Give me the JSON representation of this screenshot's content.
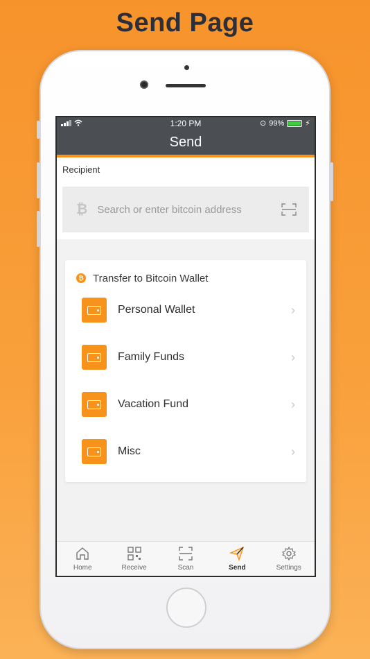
{
  "headline": "Send Page",
  "status": {
    "time": "1:20 PM",
    "battery": "99%"
  },
  "nav": {
    "title": "Send"
  },
  "recipient": {
    "label": "Recipient",
    "placeholder": "Search or enter bitcoin address",
    "value": ""
  },
  "transfer": {
    "title": "Transfer to Bitcoin Wallet",
    "wallets": [
      {
        "name": "Personal Wallet"
      },
      {
        "name": "Family Funds"
      },
      {
        "name": "Vacation Fund"
      },
      {
        "name": "Misc"
      }
    ]
  },
  "tabs": [
    {
      "label": "Home",
      "icon": "home-icon"
    },
    {
      "label": "Receive",
      "icon": "qr-code-icon"
    },
    {
      "label": "Scan",
      "icon": "scan-icon"
    },
    {
      "label": "Send",
      "icon": "send-icon",
      "active": true
    },
    {
      "label": "Settings",
      "icon": "gear-icon"
    }
  ],
  "colors": {
    "accent": "#f7931a",
    "navbar": "#4b4f54",
    "background": "#f7932b"
  }
}
